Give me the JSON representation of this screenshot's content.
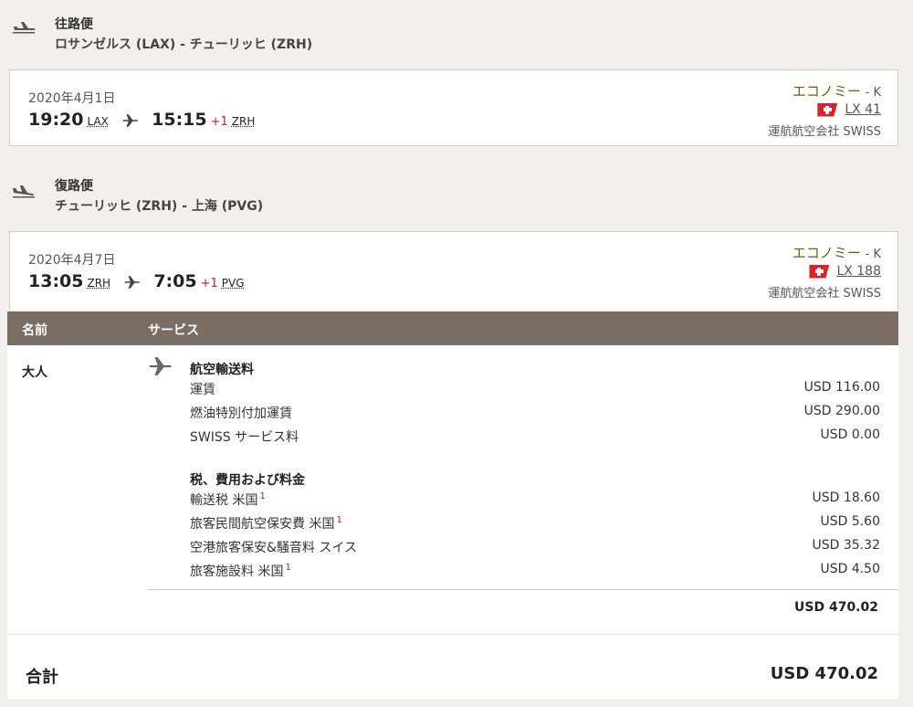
{
  "outbound": {
    "title": "往路便",
    "route": "ロサンゼルス (LAX) - チューリッヒ (ZRH)",
    "date": "2020年4月1日",
    "depart_time": "19:20",
    "depart_code": "LAX",
    "arrive_time": "15:15",
    "day_offset": "+1",
    "arrive_code": "ZRH",
    "cabin": "エコノミー",
    "cabin_class": "- K",
    "flight_no": "LX 41",
    "operator": "運航航空会社 SWISS"
  },
  "inbound": {
    "title": "復路便",
    "route": "チューリッヒ (ZRH) - 上海 (PVG)",
    "date": "2020年4月7日",
    "depart_time": "13:05",
    "depart_code": "ZRH",
    "arrive_time": "7:05",
    "day_offset": "+1",
    "arrive_code": "PVG",
    "cabin": "エコノミー",
    "cabin_class": "- K",
    "flight_no": "LX 188",
    "operator": "運航航空会社 SWISS"
  },
  "table": {
    "col_name": "名前",
    "col_service": "サービス",
    "passenger": "大人",
    "fare_section": "航空輸送料",
    "fare_rows": [
      {
        "label": "運賃",
        "amount": "USD 116.00",
        "note": ""
      },
      {
        "label": "燃油特別付加運賃",
        "amount": "USD 290.00",
        "note": ""
      },
      {
        "label": "SWISS サービス料",
        "amount": "USD 0.00",
        "note": ""
      }
    ],
    "tax_section": "税、費用および料金",
    "tax_rows": [
      {
        "label": "輸送税 米国",
        "note": "1",
        "amount": "USD 18.60"
      },
      {
        "label": "旅客民間航空保安費 米国",
        "note": "1",
        "amount": "USD 5.60"
      },
      {
        "label": "空港旅客保安&騒音料 スイス",
        "note": "",
        "amount": "USD 35.32"
      },
      {
        "label": "旅客施設料 米国",
        "note": "1",
        "amount": "USD 4.50"
      }
    ],
    "subtotal": "USD  470.02",
    "total_label": "合計",
    "total_amount": "USD  470.02"
  },
  "colors": {
    "header_bg": "#7a6e64",
    "cabin_text": "#6e5a14",
    "accent_red": "#b0262a",
    "swiss_red": "#d8232a"
  }
}
